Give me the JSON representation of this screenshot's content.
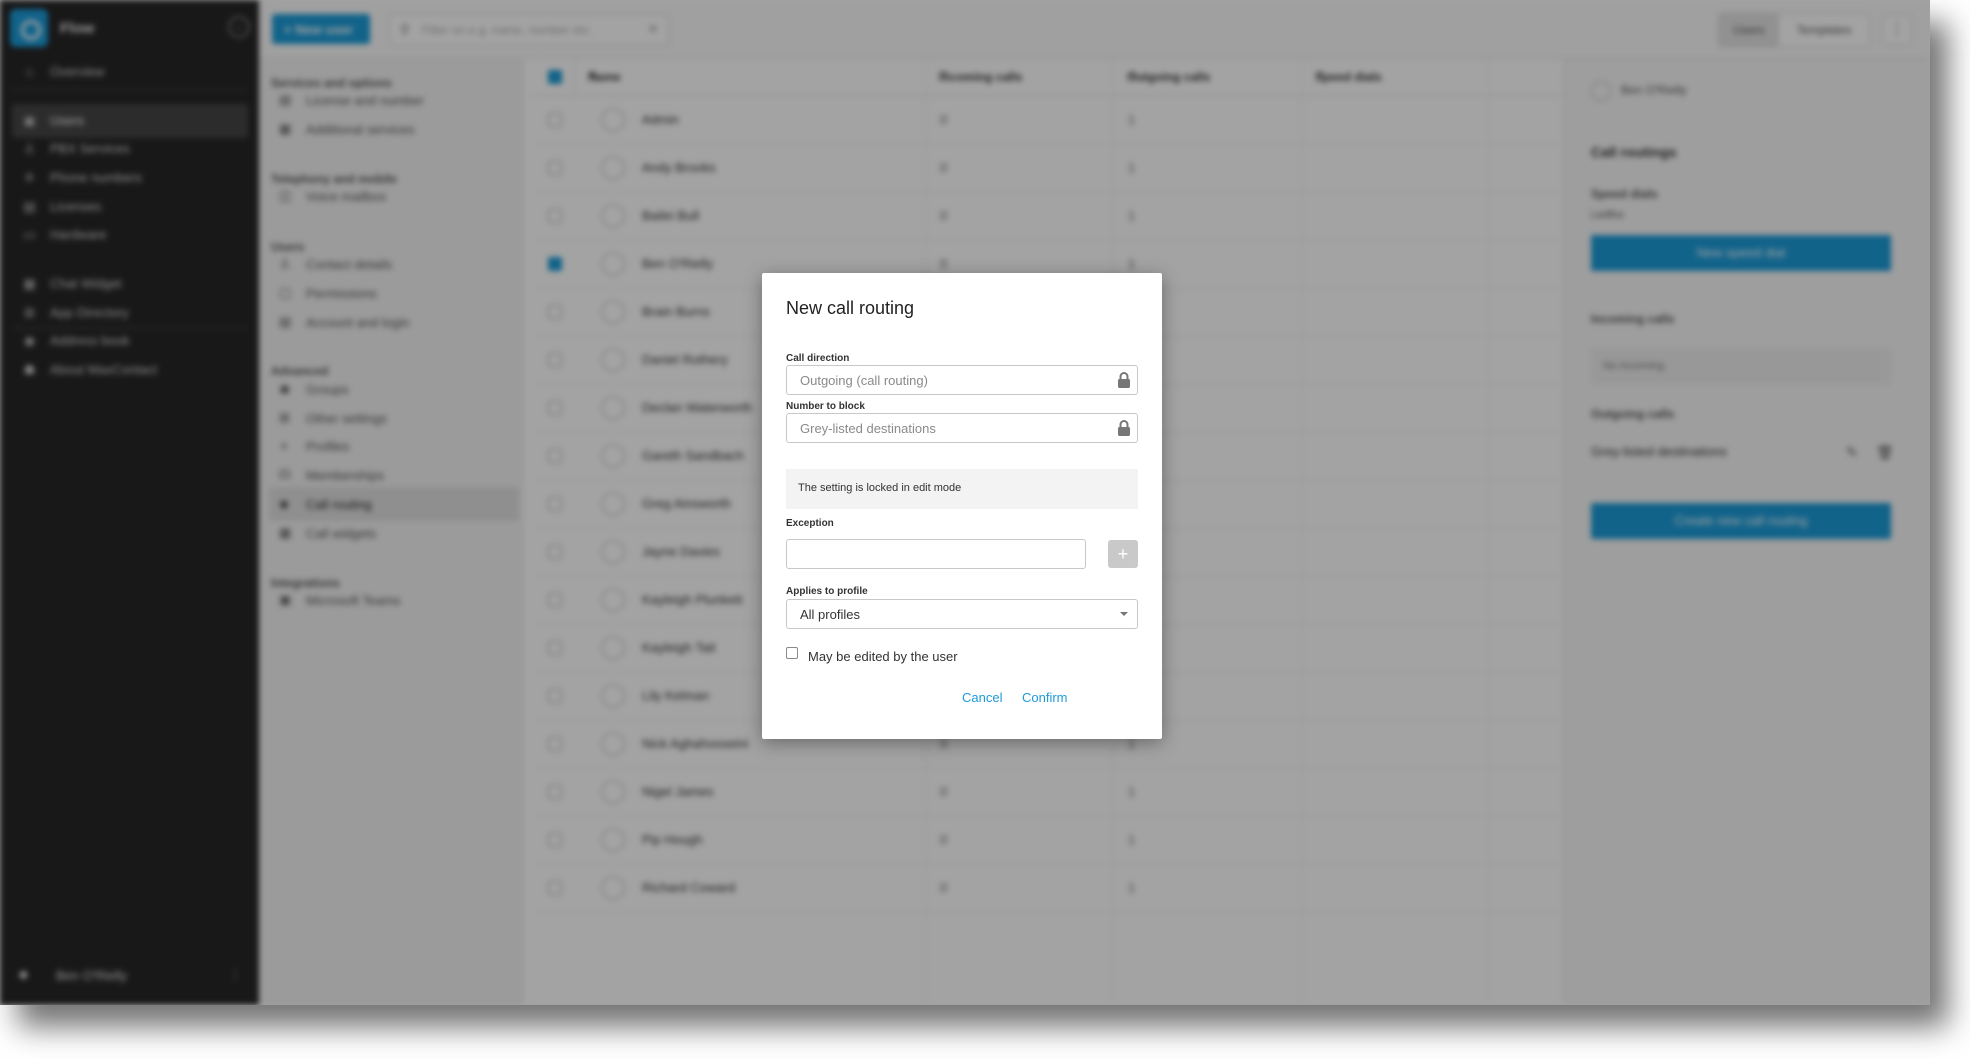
{
  "sidebar": {
    "app_name": "Flow",
    "nav": [
      {
        "label": "Overview",
        "icon": "home-icon",
        "glyph": "⌂"
      },
      {
        "label": "Users",
        "icon": "users-icon",
        "glyph": "▣"
      },
      {
        "label": "PBX Services",
        "icon": "pbx-icon",
        "glyph": "♙"
      },
      {
        "label": "Phone numbers",
        "icon": "phone-numbers-icon",
        "glyph": "✛"
      },
      {
        "label": "Licenses",
        "icon": "licenses-icon",
        "glyph": "▤"
      },
      {
        "label": "Hardware",
        "icon": "hardware-icon",
        "glyph": "▭"
      },
      {
        "label": "Chat Widget",
        "icon": "chat-widget-icon",
        "glyph": "▦"
      },
      {
        "label": "App Directory",
        "icon": "app-directory-icon",
        "glyph": "⊞"
      },
      {
        "label": "Address book",
        "icon": "address-book-icon",
        "glyph": "◉"
      },
      {
        "label": "About MaxContact",
        "icon": "about-icon",
        "glyph": "☗"
      }
    ],
    "user_name": "Ben O'Rielly"
  },
  "topbar": {
    "new_user_label": "+ New user",
    "filter_placeholder": "Filter on e.g. name, number etc.",
    "toggle_users": "Users",
    "toggle_templates": "Templates"
  },
  "options": {
    "sections": [
      {
        "heading": "Services and options",
        "items": [
          "License and number",
          "Additional services"
        ]
      },
      {
        "heading": "Telephony and mobile",
        "items": [
          "Voice mailbox"
        ]
      },
      {
        "heading": "Users",
        "items": [
          "Contact details",
          "Permissions",
          "Account and login"
        ]
      },
      {
        "heading": "Advanced",
        "items": [
          "Groups",
          "Other settings",
          "Profiles",
          "Memberships",
          "Call routing",
          "Call widgets"
        ]
      },
      {
        "heading": "Integrations",
        "items": [
          "Microsoft Teams"
        ]
      }
    ],
    "active_item": "Call routing"
  },
  "table": {
    "columns": [
      "Name",
      "Incoming calls",
      "Outgoing calls",
      "Speed dials"
    ],
    "rows": [
      {
        "name": "Admin",
        "incoming": "0",
        "outgoing": "1",
        "checked": false
      },
      {
        "name": "Andy Brooks",
        "incoming": "0",
        "outgoing": "1",
        "checked": false
      },
      {
        "name": "Bailei Bull",
        "incoming": "0",
        "outgoing": "1",
        "checked": false
      },
      {
        "name": "Ben O'Rielly",
        "incoming": "0",
        "outgoing": "1",
        "checked": true
      },
      {
        "name": "Brain Burns",
        "incoming": "0",
        "outgoing": "1",
        "checked": false
      },
      {
        "name": "Daniel Rothery",
        "incoming": "0",
        "outgoing": "1",
        "checked": false
      },
      {
        "name": "Declan Waterworth",
        "incoming": "0",
        "outgoing": "1",
        "checked": false
      },
      {
        "name": "Gareth Sandbach",
        "incoming": "0",
        "outgoing": "1",
        "checked": false
      },
      {
        "name": "Greg Ainsworth",
        "incoming": "0",
        "outgoing": "1",
        "checked": false
      },
      {
        "name": "Jayne Davies",
        "incoming": "0",
        "outgoing": "1",
        "checked": false
      },
      {
        "name": "Kayleigh Plunkett",
        "incoming": "0",
        "outgoing": "1",
        "checked": false
      },
      {
        "name": "Kayleigh Tait",
        "incoming": "0",
        "outgoing": "1",
        "checked": false
      },
      {
        "name": "Lily Kelman",
        "incoming": "0",
        "outgoing": "1",
        "checked": false
      },
      {
        "name": "Nick Aghahosseini",
        "incoming": "0",
        "outgoing": "1",
        "checked": false
      },
      {
        "name": "Nigel James",
        "incoming": "0",
        "outgoing": "1",
        "checked": false
      },
      {
        "name": "Pip Hough",
        "incoming": "0",
        "outgoing": "1",
        "checked": false
      },
      {
        "name": "Richard Coward",
        "incoming": "0",
        "outgoing": "1",
        "checked": false
      }
    ]
  },
  "right_panel": {
    "user": "Ben O'Rielly",
    "title": "Call routings",
    "speed_dials_heading": "Speed dials",
    "speed_dials_sub": "Ledfox",
    "new_speed_dial_label": "New speed dial",
    "incoming_heading": "Incoming calls",
    "incoming_empty": "No incoming",
    "outgoing_heading": "Outgoing calls",
    "outgoing_item": "Grey-listed destinations",
    "create_label": "Create new call routing"
  },
  "dialog": {
    "title": "New call routing",
    "call_direction_label": "Call direction",
    "call_direction_value": "Outgoing (call routing)",
    "number_to_block_label": "Number to block",
    "number_to_block_value": "Grey-listed destinations",
    "locked_note": "The setting is locked in edit mode",
    "exception_label": "Exception",
    "exception_value": "",
    "applies_label": "Applies to profile",
    "applies_value": "All profiles",
    "editable_label": "May be edited by the user",
    "editable_checked": false,
    "cancel_label": "Cancel",
    "confirm_label": "Confirm"
  },
  "colors": {
    "accent": "#1c9bd8",
    "sidebar_bg": "#272727"
  }
}
